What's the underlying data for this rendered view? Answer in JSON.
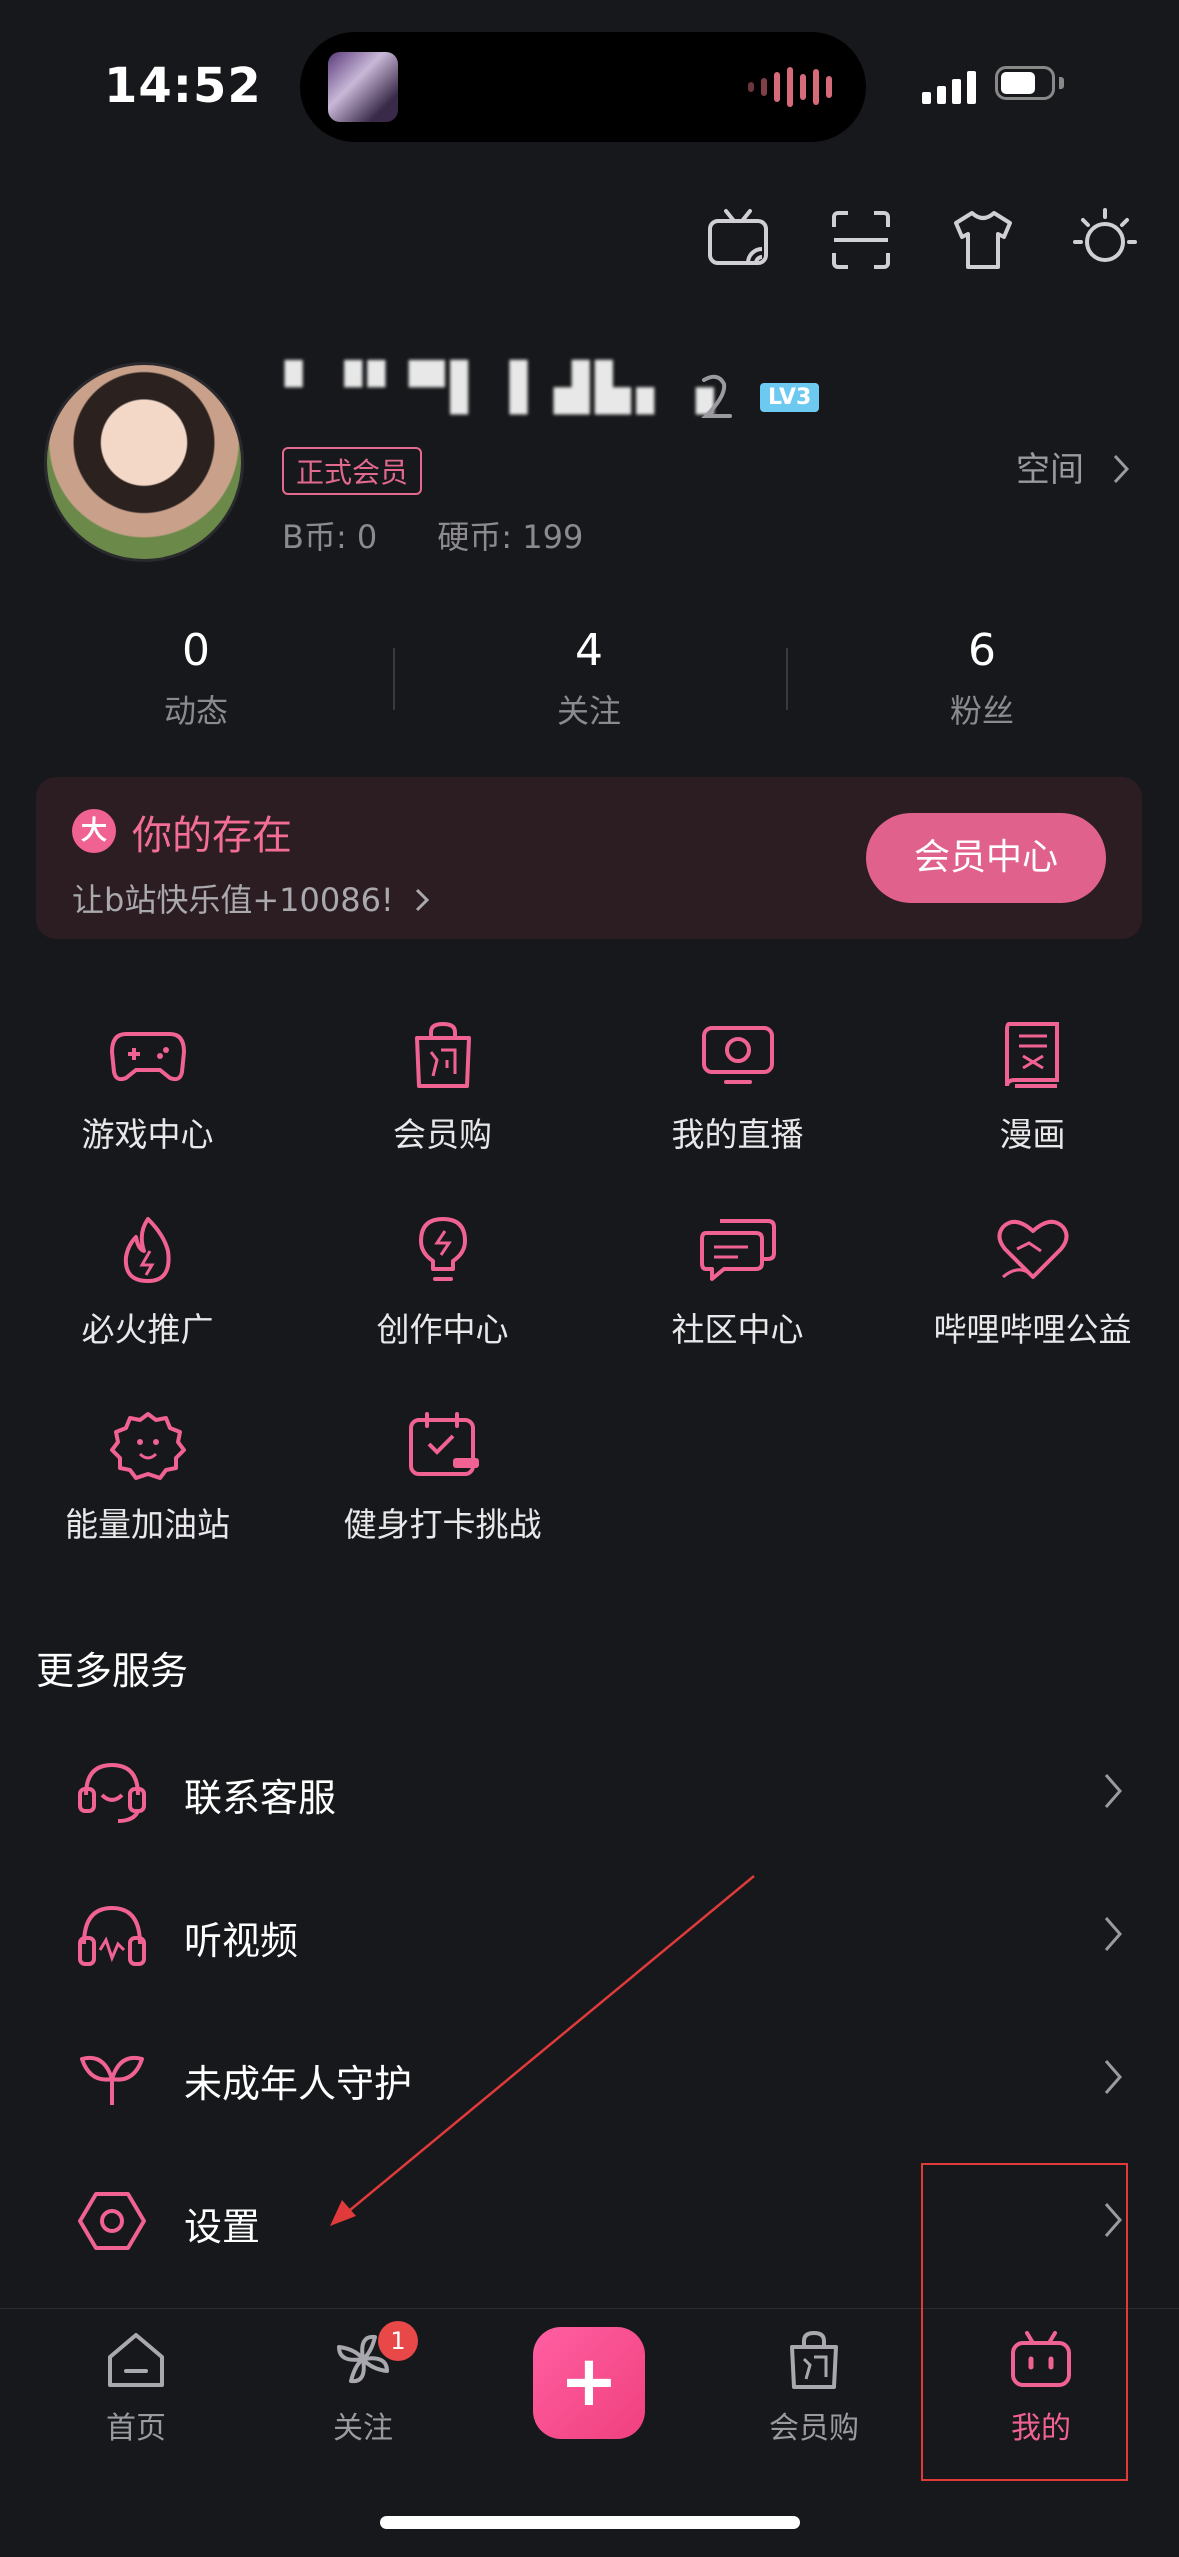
{
  "status_bar": {
    "time": "14:52"
  },
  "profile": {
    "username": "▘▝▘▀▌▐ ▟▙▖▗",
    "level_badge": "LV3",
    "member_tag": "正式会员",
    "b_coin": "B币: 0",
    "hard_coin": "硬币: 199",
    "space_link": "空间"
  },
  "stats": [
    {
      "value": "0",
      "label": "动态"
    },
    {
      "value": "4",
      "label": "关注"
    },
    {
      "value": "6",
      "label": "粉丝"
    }
  ],
  "vip_banner": {
    "badge": "大",
    "title": "你的存在",
    "subtitle": "让b站快乐值+10086!",
    "button": "会员中心"
  },
  "grid": [
    {
      "label": "游戏中心",
      "icon": "gamepad-icon"
    },
    {
      "label": "会员购",
      "icon": "shopping-bag-icon"
    },
    {
      "label": "我的直播",
      "icon": "live-tv-icon"
    },
    {
      "label": "漫画",
      "icon": "comic-book-icon"
    },
    {
      "label": "必火推广",
      "icon": "flame-icon"
    },
    {
      "label": "创作中心",
      "icon": "lightbulb-icon"
    },
    {
      "label": "社区中心",
      "icon": "chat-bubbles-icon"
    },
    {
      "label": "哔哩哔哩公益",
      "icon": "heart-icon"
    },
    {
      "label": "能量加油站",
      "icon": "mascot-icon"
    },
    {
      "label": "健身打卡挑战",
      "icon": "calendar-fitness-icon"
    }
  ],
  "more_services": {
    "title": "更多服务",
    "items": [
      {
        "label": "联系客服",
        "icon": "headset-icon"
      },
      {
        "label": "听视频",
        "icon": "headphones-icon"
      },
      {
        "label": "未成年人守护",
        "icon": "sprout-icon"
      },
      {
        "label": "设置",
        "icon": "settings-hexagon-icon"
      }
    ]
  },
  "tab_bar": {
    "tabs": [
      {
        "label": "首页",
        "icon": "home-icon"
      },
      {
        "label": "关注",
        "icon": "pinwheel-icon",
        "badge": "1"
      },
      {
        "label": "+",
        "icon": "plus-icon"
      },
      {
        "label": "会员购",
        "icon": "shopping-bag-icon"
      },
      {
        "label": "我的",
        "icon": "bilibili-tv-icon"
      }
    ]
  },
  "colors": {
    "accent": "#f06292",
    "background": "#17181b",
    "annotation": "#e03a3a"
  }
}
